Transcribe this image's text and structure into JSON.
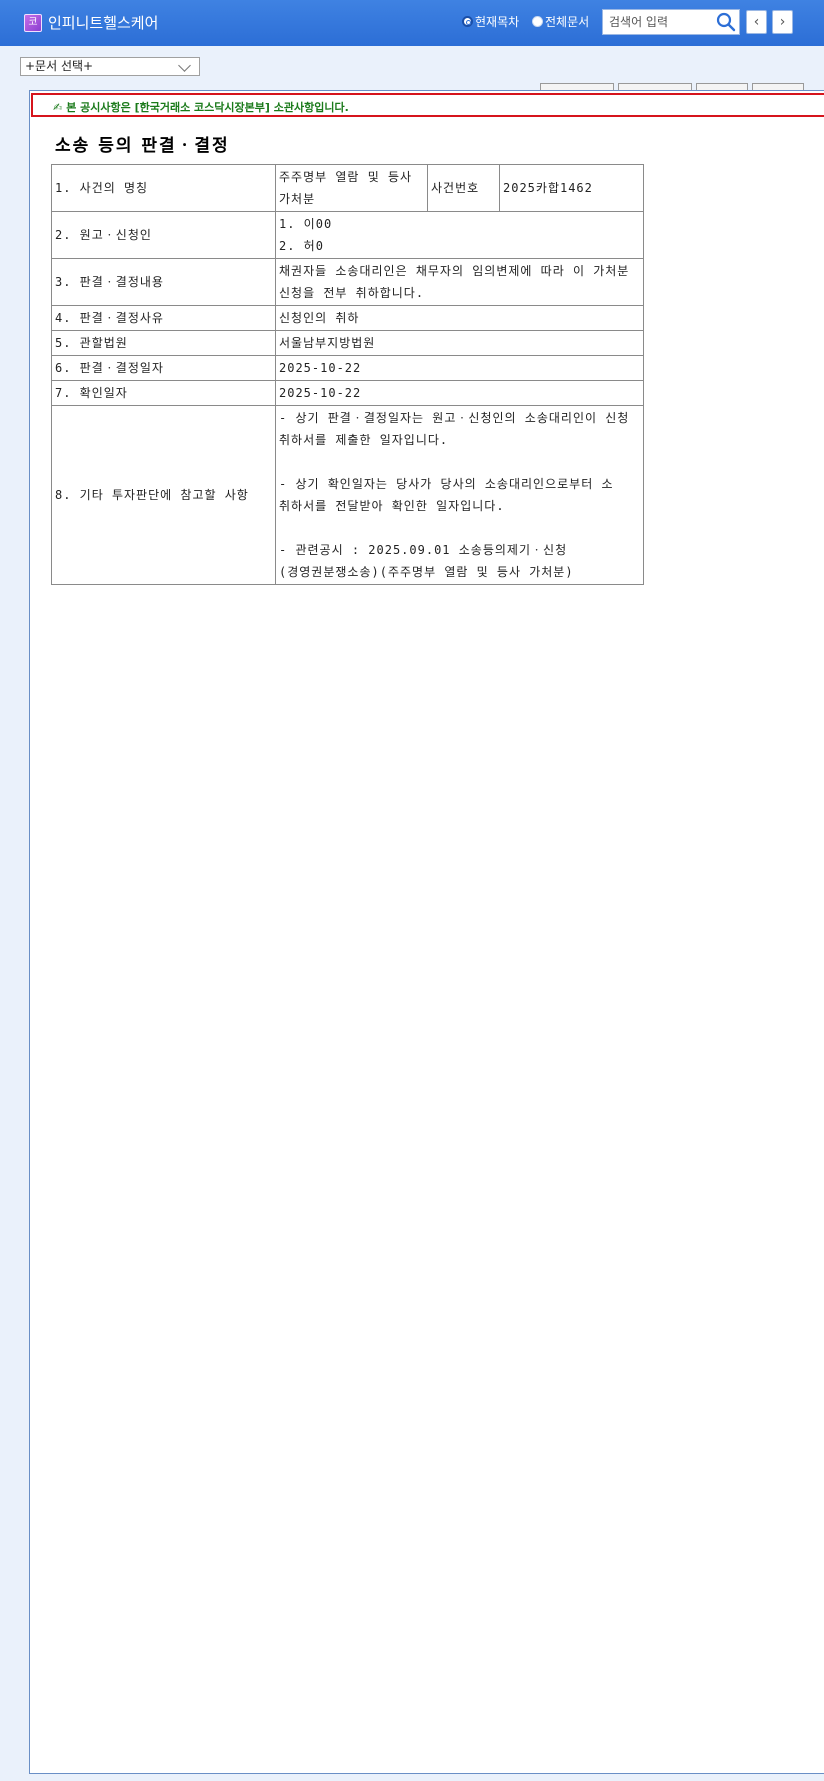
{
  "header": {
    "logo_char": "코",
    "company_name": "인피니트헬스케어",
    "radio_current": "현재목차",
    "radio_all": "전체문서",
    "search_placeholder": "검색어 입력",
    "prev_symbol": "‹",
    "next_symbol": "›",
    "colors": {
      "bar": "#2c6ed6",
      "frame_border": "#6a8fc6",
      "notice_border": "#d6141c",
      "notice_text": "#1a7a1a"
    }
  },
  "doc_select": {
    "value": "+문서 선택+"
  },
  "notice": {
    "text": "본 공시사항은 [한국거래소 코스닥시장본부] 소관사항입니다."
  },
  "document": {
    "title": "소송 등의 판결ㆍ결정",
    "rows": [
      {
        "label": "1. 사건의 명칭",
        "value": "주주명부 열람 및 등사 가처분",
        "sub_label": "사건번호",
        "sub_value": "2025카합1462"
      },
      {
        "label": "2. 원고ㆍ신청인",
        "lines": [
          "1. 이00",
          "2. 허0"
        ]
      },
      {
        "label": "3. 판결ㆍ결정내용",
        "value": "채권자들 소송대리인은 채무자의 임의변제에 따라 이 가처분 신청을 전부 취하합니다."
      },
      {
        "label": "4. 판결ㆍ결정사유",
        "value": "신청인의 취하"
      },
      {
        "label": "5. 관할법원",
        "value": "서울남부지방법원"
      },
      {
        "label": "6. 판결ㆍ결정일자",
        "value": "2025-10-22"
      },
      {
        "label": "7. 확인일자",
        "value": "2025-10-22"
      },
      {
        "label": "8. 기타 투자판단에 참고할 사항",
        "lines": [
          "- 상기 판결ㆍ결정일자는 원고ㆍ신청인의 소송대리인이 신청 취하서를 제출한 일자입니다.",
          "",
          "- 상기 확인일자는 당사가 당사의 소송대리인으로부터 소 취하서를 전달받아 확인한 일자입니다.",
          "",
          "- 관련공시 : 2025.09.01 소송등의제기ㆍ신청(경영권분쟁소송)(주주명부 열람 및 등사 가처분)"
        ]
      }
    ]
  }
}
